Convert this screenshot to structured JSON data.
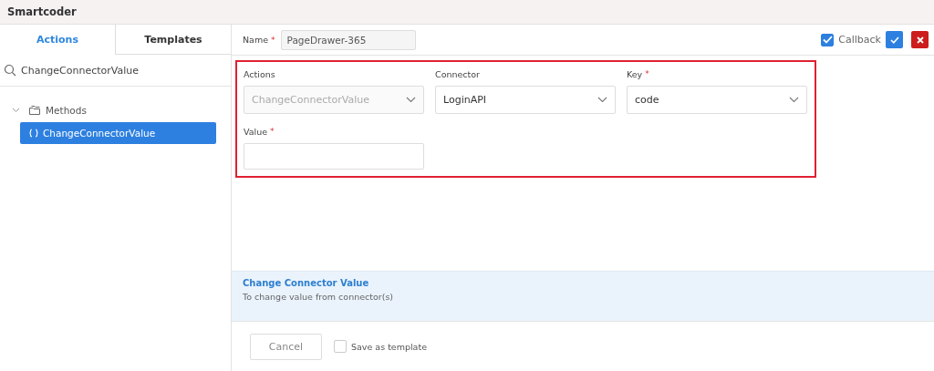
{
  "window": {
    "title": "Smartcoder"
  },
  "tabs": [
    {
      "label": "Actions",
      "selected": true
    },
    {
      "label": "Templates",
      "selected": false
    }
  ],
  "search": {
    "value": "ChangeConnectorValue"
  },
  "tree": [
    {
      "label": "Methods",
      "expanded": true,
      "selected": false,
      "children": [
        {
          "label": "ChangeConnectorValue",
          "selected": true
        }
      ]
    }
  ],
  "name_field": {
    "label": "Name",
    "required_mark": "*",
    "value": "PageDrawer-365"
  },
  "callback": {
    "label": "Callback",
    "checked": true
  },
  "fields": [
    {
      "kind": "select",
      "label": "Actions",
      "value": "ChangeConnectorValue",
      "disabled": true
    },
    {
      "kind": "select",
      "label": "Connector",
      "value": "LoginAPI",
      "disabled": false
    },
    {
      "kind": "select",
      "label": "Key",
      "required_mark": "*",
      "value": "code",
      "disabled": false
    },
    {
      "kind": "input",
      "label": "Value",
      "required_mark": "*"
    }
  ],
  "info": {
    "title": "Change Connector Value",
    "description": "To change value from connector(s)"
  },
  "footer": {
    "cancel": "Cancel",
    "save_template": {
      "label": "Save as template",
      "checked": false
    }
  }
}
